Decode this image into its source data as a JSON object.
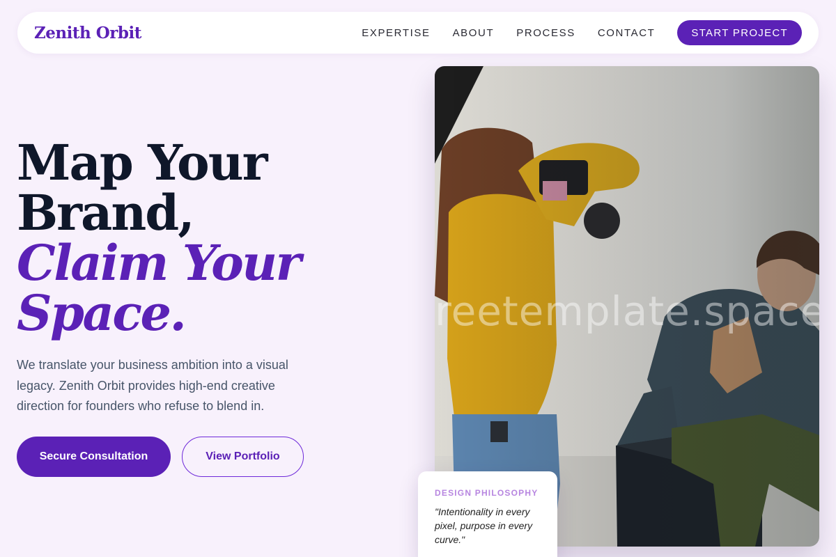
{
  "nav": {
    "brand": "Zenith Orbit",
    "links": [
      "EXPERTISE",
      "ABOUT",
      "PROCESS",
      "CONTACT"
    ],
    "cta": "START PROJECT"
  },
  "hero": {
    "headline_line1": "Map Your",
    "headline_line2": "Brand,",
    "headline_line3": "Claim Your",
    "headline_line4": "Space.",
    "lead": "We translate your business ambition into a visual legacy. Zenith Orbit provides high-end creative direction for founders who refuse to blend in.",
    "primary_button": "Secure Consultation",
    "secondary_button": "View Portfolio"
  },
  "photo": {
    "watermark": "reetemplate.space"
  },
  "card": {
    "label": "DESIGN PHILOSOPHY",
    "quote": "\"Intentionality in every pixel, purpose in every curve.\""
  },
  "colors": {
    "accent": "#5b21b6",
    "background": "#f8f1fc",
    "heading": "#0f172a"
  }
}
